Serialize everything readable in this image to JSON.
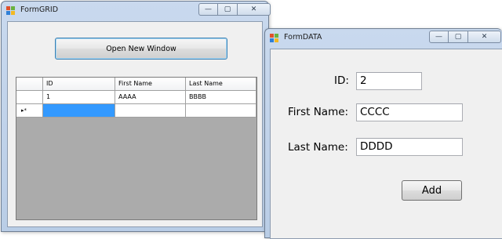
{
  "form_grid": {
    "title": "FormGRID",
    "open_button_label": "Open New Window",
    "grid": {
      "columns": [
        "ID",
        "First Name",
        "Last Name"
      ],
      "rows": [
        {
          "id": "1",
          "first_name": "AAAA",
          "last_name": "BBBB"
        }
      ],
      "new_row_marker": "▸*"
    }
  },
  "form_data": {
    "title": "FormDATA",
    "id_label": "ID:",
    "id_value": "2",
    "first_name_label": "First Name:",
    "first_name_value": "CCCC",
    "last_name_label": "Last Name:",
    "last_name_value": "DDDD",
    "add_button_label": "Add"
  },
  "caption_glyphs": {
    "minimize": "—",
    "maximize": "▢",
    "close": "✕"
  },
  "icons": {
    "form_icon": "windows-form-icon"
  },
  "colors": {
    "selection": "#3399ff",
    "grid_background": "#ababab",
    "accent_border": "#3c7fb1"
  }
}
